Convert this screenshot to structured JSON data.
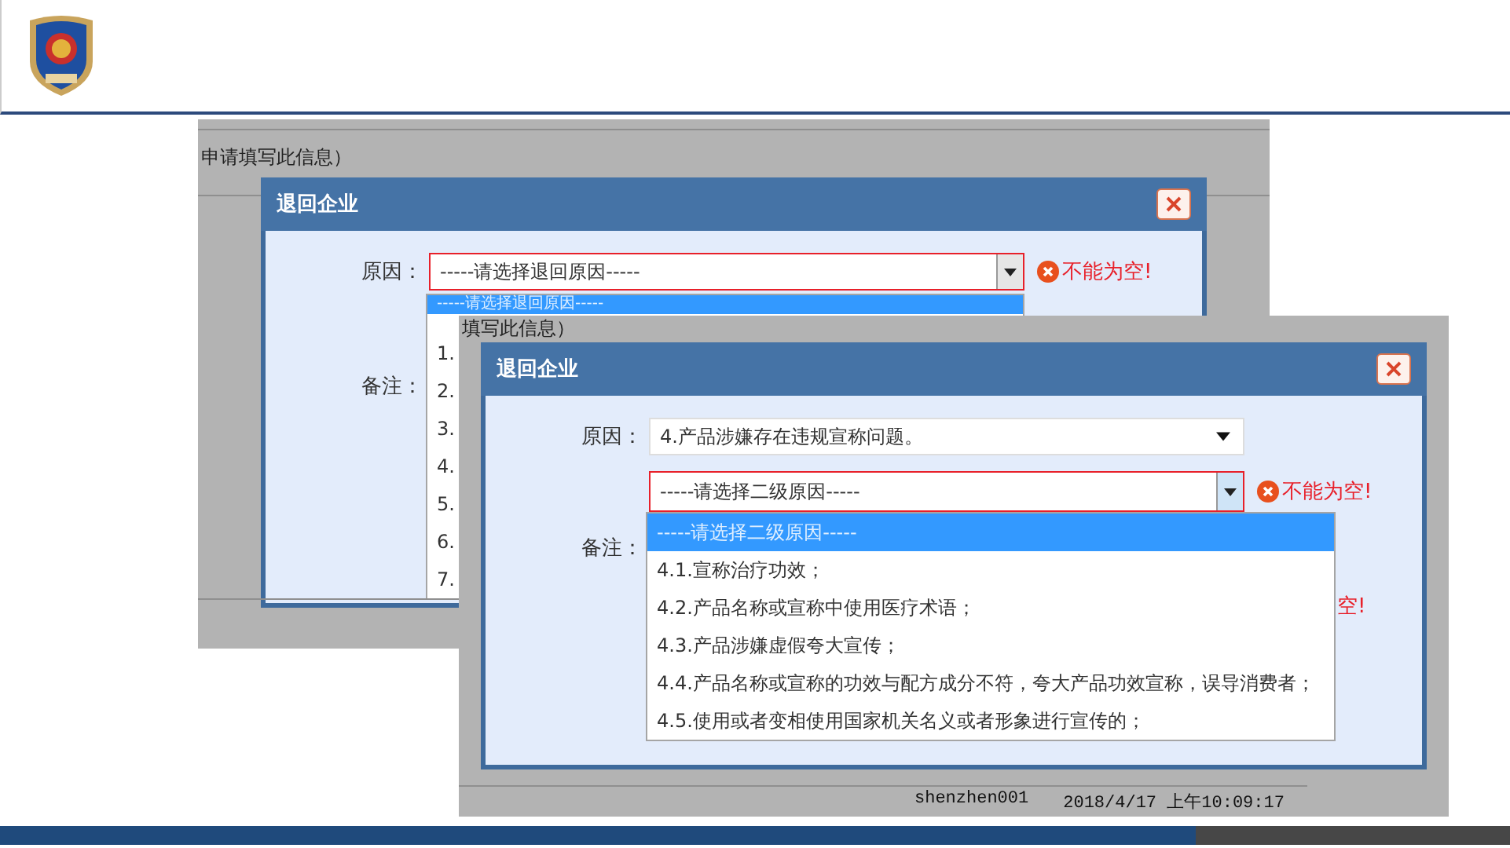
{
  "back_screenshot": {
    "page_text": "申请填写此信息）",
    "dialog": {
      "title": "退回企业",
      "reason_label": "原因：",
      "reason_select": {
        "value": "-----请选择退回原因-----",
        "invalid": true
      },
      "error": "不能为空!",
      "remarks_label": "备注：",
      "dropdown": [
        {
          "label": "-----请选择退回原因-----",
          "selected": true
        },
        {
          "label": "1.",
          "selected": false
        },
        {
          "label": "2.",
          "selected": false
        },
        {
          "label": "3.",
          "selected": false
        },
        {
          "label": "4.",
          "selected": false
        },
        {
          "label": "5.",
          "selected": false
        },
        {
          "label": "6.",
          "selected": false
        },
        {
          "label": "7.",
          "selected": false
        }
      ]
    }
  },
  "front_screenshot": {
    "page_text": "填写此信息）",
    "dialog": {
      "title": "退回企业",
      "reason_label": "原因：",
      "reason_select": {
        "value": "4.产品涉嫌存在违规宣称问题。",
        "invalid": false
      },
      "sub_reason_select": {
        "value": "-----请选择二级原因-----",
        "invalid": true
      },
      "error": "不能为空!",
      "remarks_label": "备注：",
      "covered_error": "空!",
      "dropdown": [
        {
          "label": "-----请选择二级原因-----",
          "selected": true
        },
        {
          "label": "4.1.宣称治疗功效；",
          "selected": false
        },
        {
          "label": "4.2.产品名称或宣称中使用医疗术语；",
          "selected": false
        },
        {
          "label": "4.3.产品涉嫌虚假夸大宣传；",
          "selected": false
        },
        {
          "label": "4.4.产品名称或宣称的功效与配方成分不符，夸大产品功效宣称，误导消费者；",
          "selected": false
        },
        {
          "label": "4.5.使用或者变相使用国家机关名义或者形象进行宣传的；",
          "selected": false
        }
      ]
    },
    "footer": {
      "user": "shenzhen001",
      "timestamp": "2018/4/17 上午10:09:17"
    }
  }
}
